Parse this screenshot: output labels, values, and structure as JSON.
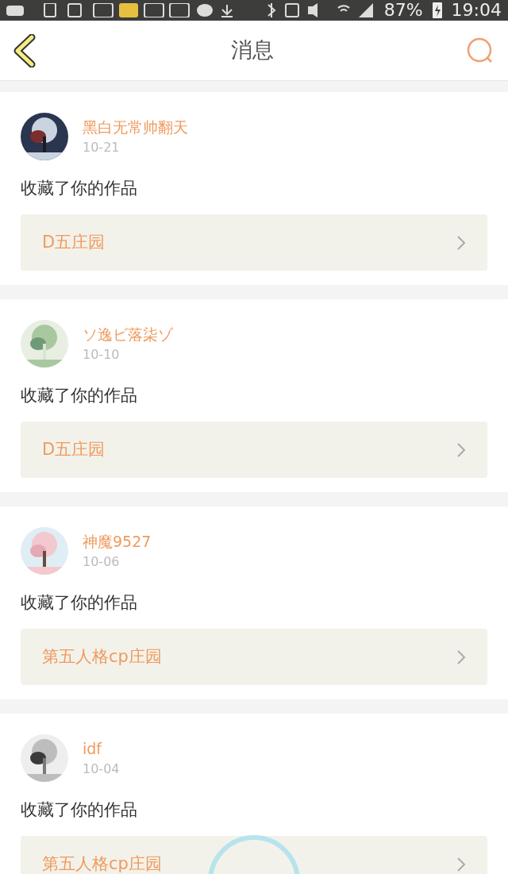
{
  "status_bar": {
    "battery": "87%",
    "time": "19:04"
  },
  "header": {
    "title": "消息"
  },
  "messages": [
    {
      "user": "黑白无常帅翻天",
      "date": "10-21",
      "action": "收藏了你的作品",
      "work": "D五庄园"
    },
    {
      "user": "ソ逸ビ落柒ゾ",
      "date": "10-10",
      "action": "收藏了你的作品",
      "work": "D五庄园"
    },
    {
      "user": "神魔9527",
      "date": "10-06",
      "action": "收藏了你的作品",
      "work": "第五人格cp庄园"
    },
    {
      "user": "idf",
      "date": "10-04",
      "action": "收藏了你的作品",
      "work": "第五人格cp庄园"
    }
  ]
}
